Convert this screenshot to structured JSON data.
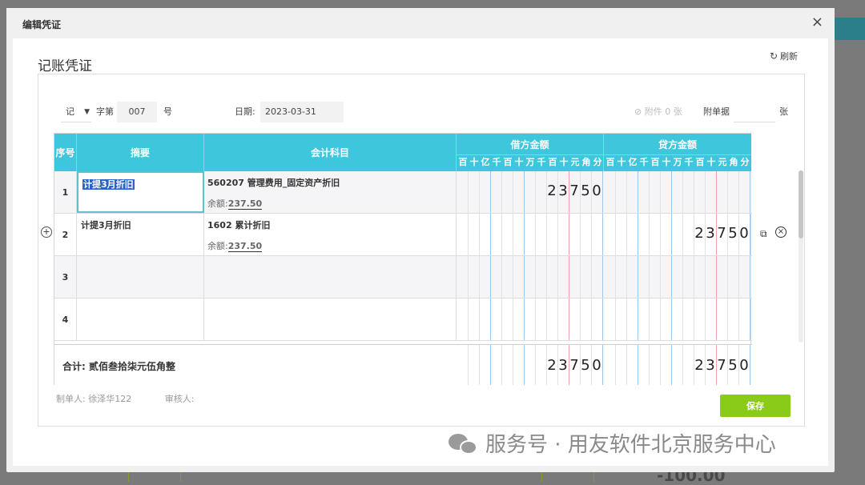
{
  "modal": {
    "title": "编辑凭证",
    "close_glyph": "×"
  },
  "voucher": {
    "heading": "记账凭证",
    "refresh_label": "刷新",
    "word": "记",
    "word_label": "字第",
    "number": "007",
    "number_unit": "号",
    "date_label": "日期:",
    "date": "2023-03-31",
    "attachment": "附件 0 张",
    "voucher_count_label": "附单据",
    "voucher_count_unit": "张"
  },
  "table": {
    "headers": {
      "seq": "序号",
      "summary": "摘要",
      "account": "会计科目",
      "debit": "借方金额",
      "credit": "贷方金额"
    },
    "digit_units": [
      "百",
      "十",
      "亿",
      "千",
      "百",
      "十",
      "万",
      "千",
      "百",
      "十",
      "元",
      "角",
      "分"
    ],
    "rows": [
      {
        "seq": "1",
        "summary": "计提3月折旧",
        "account": "560207 管理费用_固定资产折旧",
        "balance_label": "余额:",
        "balance": "237.50",
        "debit": "23750",
        "credit": ""
      },
      {
        "seq": "2",
        "summary": "计提3月折旧",
        "account": "1602 累计折旧",
        "balance_label": "余额:",
        "balance": "237.50",
        "debit": "",
        "credit": "23750"
      },
      {
        "seq": "3",
        "summary": "",
        "account": "",
        "balance_label": "",
        "balance": "",
        "debit": "",
        "credit": ""
      },
      {
        "seq": "4",
        "summary": "",
        "account": "",
        "balance_label": "",
        "balance": "",
        "debit": "",
        "credit": ""
      }
    ],
    "total": {
      "label": "合计:  贰佰叁拾柒元伍角整",
      "debit": "23750",
      "credit": "23750"
    }
  },
  "footer": {
    "maker": "制单人: 徐泽华122",
    "reviewer": "审核人:"
  },
  "actions": {
    "save_label": "保存"
  },
  "watermark": {
    "text": "服务号 · 用友软件北京服务中心"
  },
  "background": {
    "amount": "-100.00"
  },
  "icons": {
    "refresh": "refresh-icon",
    "add_row": "plus-circle-icon",
    "copy_row": "copy-icon",
    "delete_row": "close-circle-icon",
    "dropdown": "caret-down-icon",
    "wechat": "wechat-icon"
  },
  "colors": {
    "header": "#3ec6dd",
    "save": "#8acb1a",
    "edit_border": "#5cc4c9",
    "yuan_line": "#f2a3a3",
    "group_line": "#9bc6ee"
  }
}
